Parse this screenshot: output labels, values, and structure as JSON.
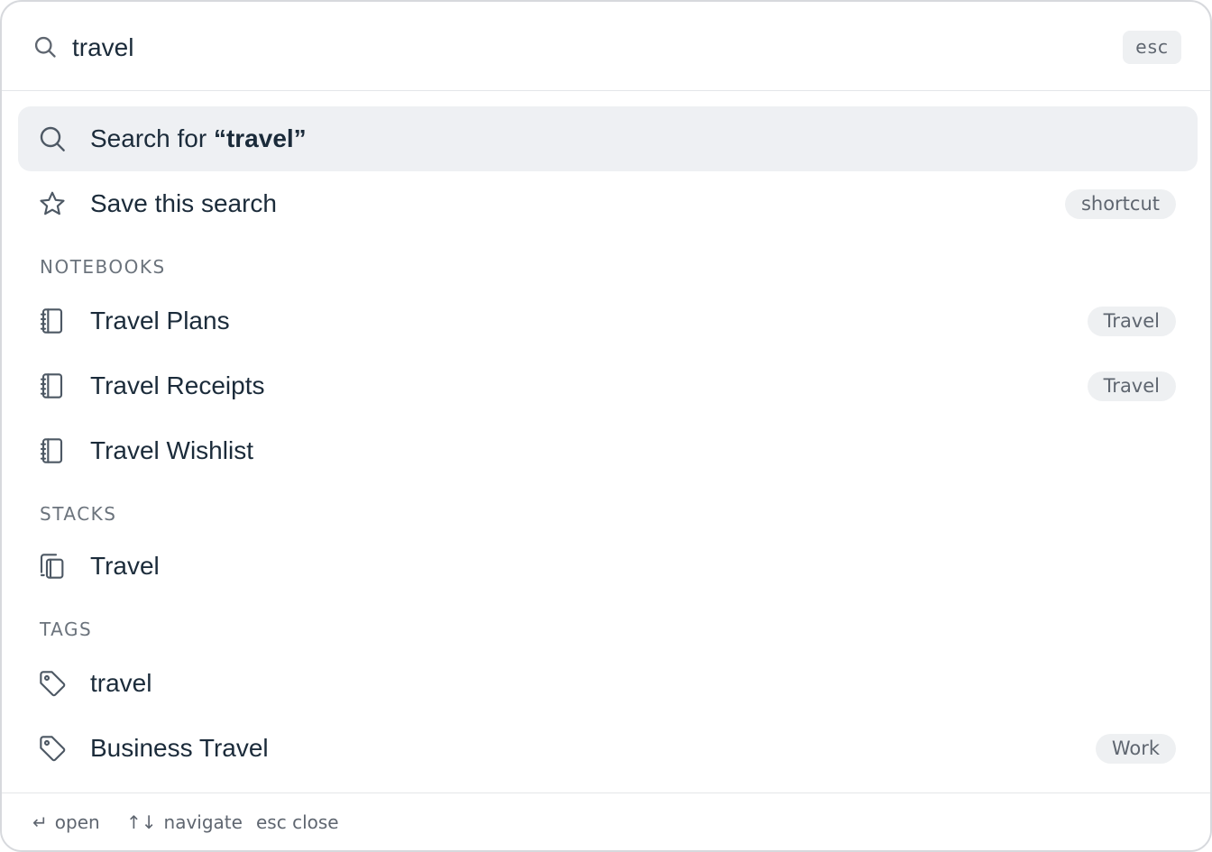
{
  "search": {
    "query": "travel",
    "placeholder": "",
    "esc_label": "esc"
  },
  "actions": {
    "search_for_prefix": "Search for ",
    "search_for_query": "“travel”",
    "save_label": "Save this search",
    "save_shortcut": "shortcut"
  },
  "sections": {
    "notebooks": "NOTEBOOKS",
    "stacks": "STACKS",
    "tags": "TAGS"
  },
  "notebooks": [
    {
      "label": "Travel Plans",
      "badge": "Travel",
      "icon": "notebook-icon"
    },
    {
      "label": "Travel Receipts",
      "badge": "Travel",
      "icon": "notebook-icon"
    },
    {
      "label": "Travel Wishlist",
      "badge": "",
      "icon": "notebook-icon"
    }
  ],
  "stacks": [
    {
      "label": "Travel",
      "icon": "stack-icon"
    }
  ],
  "tags": [
    {
      "label": "travel",
      "badge": "",
      "icon": "tag-icon"
    },
    {
      "label": "Business Travel",
      "badge": "Work",
      "icon": "tag-icon"
    }
  ],
  "footer": {
    "open_glyph": "↵",
    "open_label": "open",
    "navigate_glyph": "↑↓",
    "navigate_label": "navigate",
    "close_label": "esc close"
  },
  "colors": {
    "text": "#1b2b3a",
    "muted": "#6b737c",
    "selected_bg": "#eef0f3",
    "pill_bg": "#eef0f2"
  }
}
